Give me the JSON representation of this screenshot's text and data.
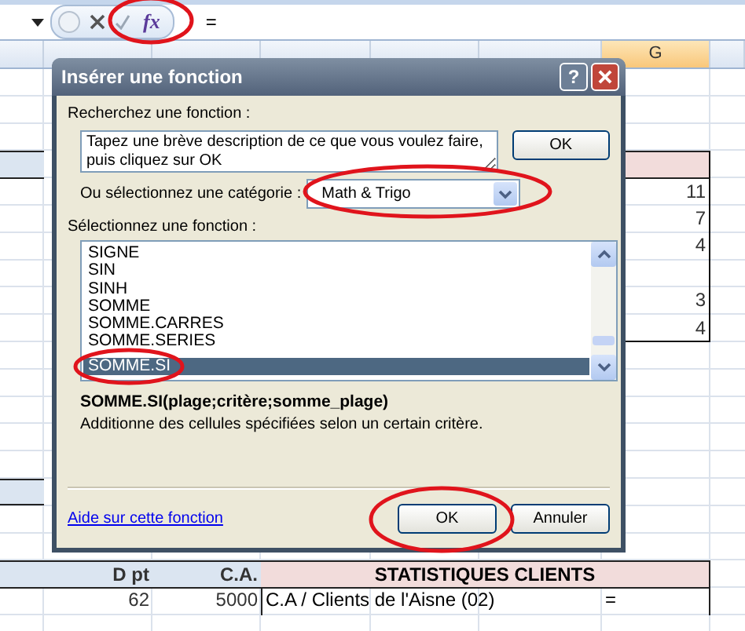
{
  "formula_bar": {
    "fx_label": "fx",
    "formula": "="
  },
  "sheet": {
    "column_header": "G",
    "g_value_groups": [
      [
        "11",
        "7",
        "4"
      ],
      [
        "3",
        "4"
      ]
    ],
    "table": {
      "columns": [
        "D pt",
        "C.A."
      ],
      "title": "STATISTIQUES CLIENTS",
      "rows": [
        {
          "dpt": "62",
          "ca": "5000",
          "label": "C.A / Clients de l'Aisne (02)",
          "value": "="
        }
      ]
    }
  },
  "dialog": {
    "title": "Insérer une fonction",
    "help_button": "?",
    "search_label": "Recherchez une fonction :",
    "search_text": "Tapez une brève description de ce que vous voulez faire, puis cliquez sur OK",
    "search_button": "OK",
    "category_label": "Ou sélectionnez une catégorie :",
    "category": "Math & Trigo",
    "function_label": "Sélectionnez une fonction :",
    "functions": [
      {
        "label": "SIGNE",
        "selected": false
      },
      {
        "label": "SIN",
        "selected": false
      },
      {
        "label": "SINH",
        "selected": false
      },
      {
        "label": "SOMME",
        "selected": false
      },
      {
        "label": "SOMME.CARRES",
        "selected": false
      },
      {
        "label": "SOMME.SERIES",
        "selected": false
      },
      {
        "label": "SOMME.SI",
        "selected": true
      }
    ],
    "signature": "SOMME.SI(plage;critère;somme_plage)",
    "description": "Additionne des cellules spécifiées selon un certain critère.",
    "help_link": "Aide sur cette fonction",
    "buttons": [
      "OK",
      "Annuler"
    ]
  }
}
